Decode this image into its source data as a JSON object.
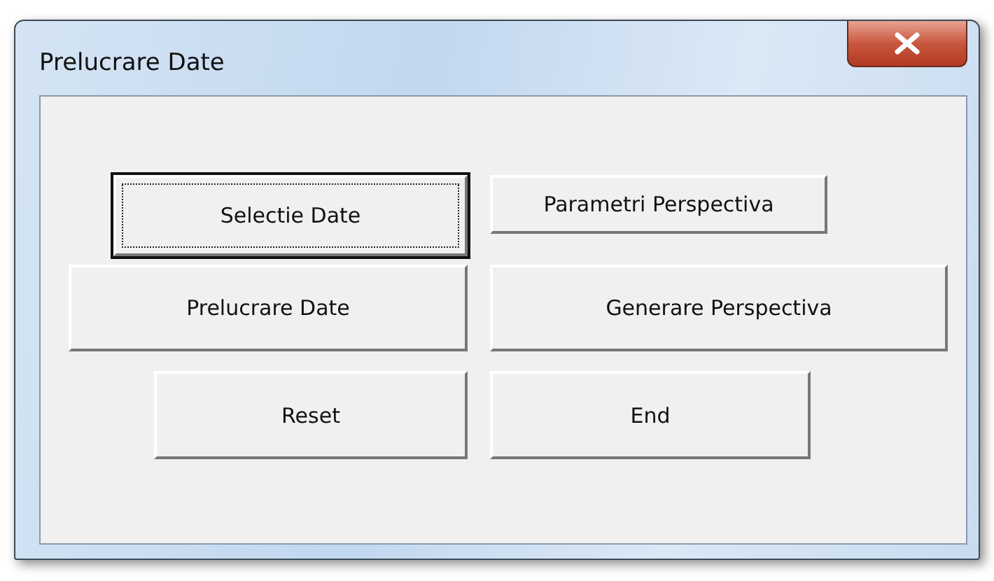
{
  "window": {
    "title": "Prelucrare Date"
  },
  "buttons": [
    {
      "label": "Selectie Date",
      "focused": true
    },
    {
      "label": "Parametri Perspectiva",
      "focused": false
    },
    {
      "label": "Prelucrare Date",
      "focused": false
    },
    {
      "label": "Generare Perspectiva",
      "focused": false
    },
    {
      "label": "Reset",
      "focused": false
    },
    {
      "label": "End",
      "focused": false
    }
  ]
}
